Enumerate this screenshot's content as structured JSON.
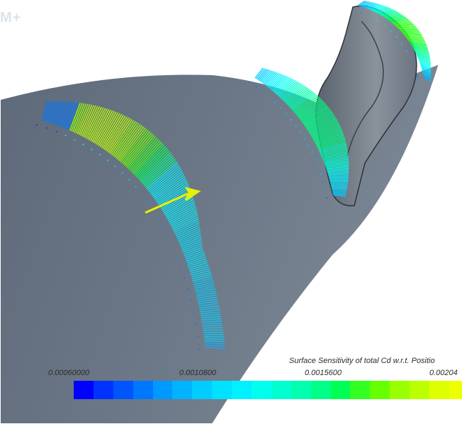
{
  "watermark": "M+",
  "legend": {
    "title": "Surface Sensitivity of total Cd w.r.t. Positio",
    "ticks": [
      "0.00060000",
      "0.0010800",
      "0.0015600",
      "0.00204"
    ],
    "colors": [
      "#0000ff",
      "#0033ff",
      "#0055ff",
      "#0077ff",
      "#0099ff",
      "#00b3ff",
      "#00ccff",
      "#00e0ff",
      "#00f0ff",
      "#00ffee",
      "#00ffd0",
      "#00ffb0",
      "#00ff88",
      "#00ff55",
      "#33ff22",
      "#66ff00",
      "#99ff00",
      "#bbff00",
      "#ddff00",
      "#eeff00"
    ]
  }
}
